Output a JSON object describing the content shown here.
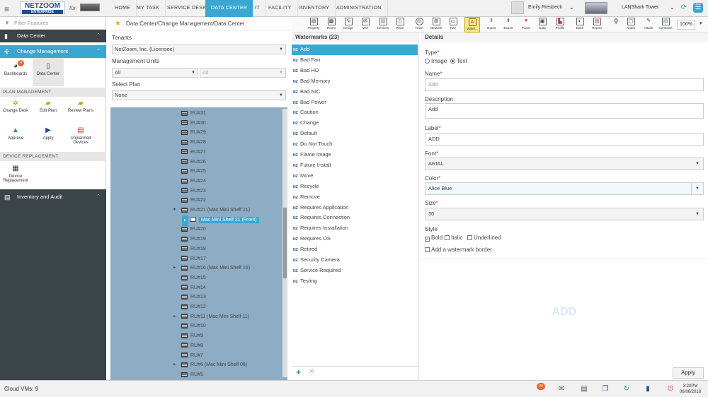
{
  "app": {
    "logo": "NETZOOM",
    "logo_sub": "ENTERPRISE",
    "for_label": "for"
  },
  "nav": [
    "HOME",
    "MY TASK",
    "SERVICE DESK",
    "DATA CENTER",
    "IT",
    "FACILITY",
    "INVENTORY",
    "ADMINISTRATION"
  ],
  "user": {
    "name": "Emily Riesbeck",
    "building": "LANShark Tower"
  },
  "toolbar": {
    "buttons": [
      "Property",
      "Room",
      "Design",
      "WO",
      "Devices",
      "Place",
      "Trace",
      "Network",
      "Nav",
      "Water...",
      "Import",
      "Export",
      "Power",
      "Data",
      "Profile",
      "Dash",
      "Report",
      "Notes",
      "Attach",
      "Contracts"
    ],
    "zoom": "100%"
  },
  "left": {
    "filter_placeholder": "Filter Features",
    "data_center": "Data Center",
    "change_management": "Change Management",
    "dashboards": "Dashboards",
    "dashboards_badge": "4",
    "data_center_tile": "Data Center",
    "plan_management": "PLAN MANAGEMENT",
    "change_desk": "Change Desk",
    "edit_plan": "Edit Plan",
    "review_plans": "Review Plans",
    "approve": "Approve",
    "apply": "Apply",
    "unplanned_devices": "Unplanned Devices",
    "device_replacement": "DEVICE REPLACEMENT",
    "device_replacement_tile": "Device Replacement",
    "inventory_audit": "Inventory and Audit"
  },
  "mid": {
    "breadcrumb": "Data Center/Change Management/Data Center",
    "tenants_label": "Tenants",
    "tenant_value": "NetZoom, Inc. (Licensee)",
    "mu_label": "Management Units",
    "mu_value1": "All",
    "mu_value2": "All",
    "plan_label": "Select Plan",
    "plan_value": "None",
    "tree": [
      "RU#31",
      "RU#30",
      "RU#29",
      "RU#28",
      "RU#27",
      "RU#26",
      "RU#25",
      "RU#24",
      "RU#23",
      "RU#22",
      "RU#21 (Mac Mini Shelf 21)",
      "Mac Mini Shelf 21 (Front)",
      "RU#20",
      "RU#19",
      "RU#18",
      "RU#17",
      "RU#16 (Mac Mini Shelf 16)",
      "RU#15",
      "RU#14",
      "RU#13",
      "RU#12",
      "RU#11 (Mac Mini Shelf 11)",
      "RU#10",
      "RU#9",
      "RU#8",
      "RU#7",
      "RU#6 (Mac Mini Shelf 06)",
      "RU#5"
    ]
  },
  "watermarks": {
    "title": "Watermarks (23)",
    "nz": "NZ",
    "items": [
      "Add",
      "Bad Fan",
      "Bad HD",
      "Bad Memory",
      "Bad NIC",
      "Bad Power",
      "Caution",
      "Change",
      "Default",
      "Do Not Touch",
      "Flame Image",
      "Future Install",
      "Move",
      "Recycle",
      "Remove",
      "Requires Application",
      "Requires Connection",
      "Requires Installation",
      "Requires OS",
      "Retired",
      "Security Camera",
      "Service Required",
      "Testing"
    ]
  },
  "details": {
    "title": "Details",
    "type_label": "Type",
    "type_image": "Image",
    "type_text": "Text",
    "name_label": "Name",
    "name_placeholder": "Add",
    "desc_label": "Description",
    "desc_value": "Add",
    "label_label": "Label",
    "label_value": "ADD",
    "font_label": "Font",
    "font_value": "ARIAL",
    "color_label": "Color",
    "color_value": "Alice Blue",
    "size_label": "Size",
    "size_value": "30",
    "style_label": "Style",
    "bold": "Bold",
    "italic": "Italic",
    "underlined": "Underlined",
    "border_label": "Add a watermark border",
    "preview_text": "ADD",
    "apply": "Apply"
  },
  "status": {
    "text": "Cloud VMs: 9",
    "badge": "24",
    "time": "3:20PM",
    "date": "06/06/2018"
  },
  "colors": {
    "accent": "#39a7d1",
    "dark": "#3a4449",
    "tree_bg": "#8eacc4"
  }
}
